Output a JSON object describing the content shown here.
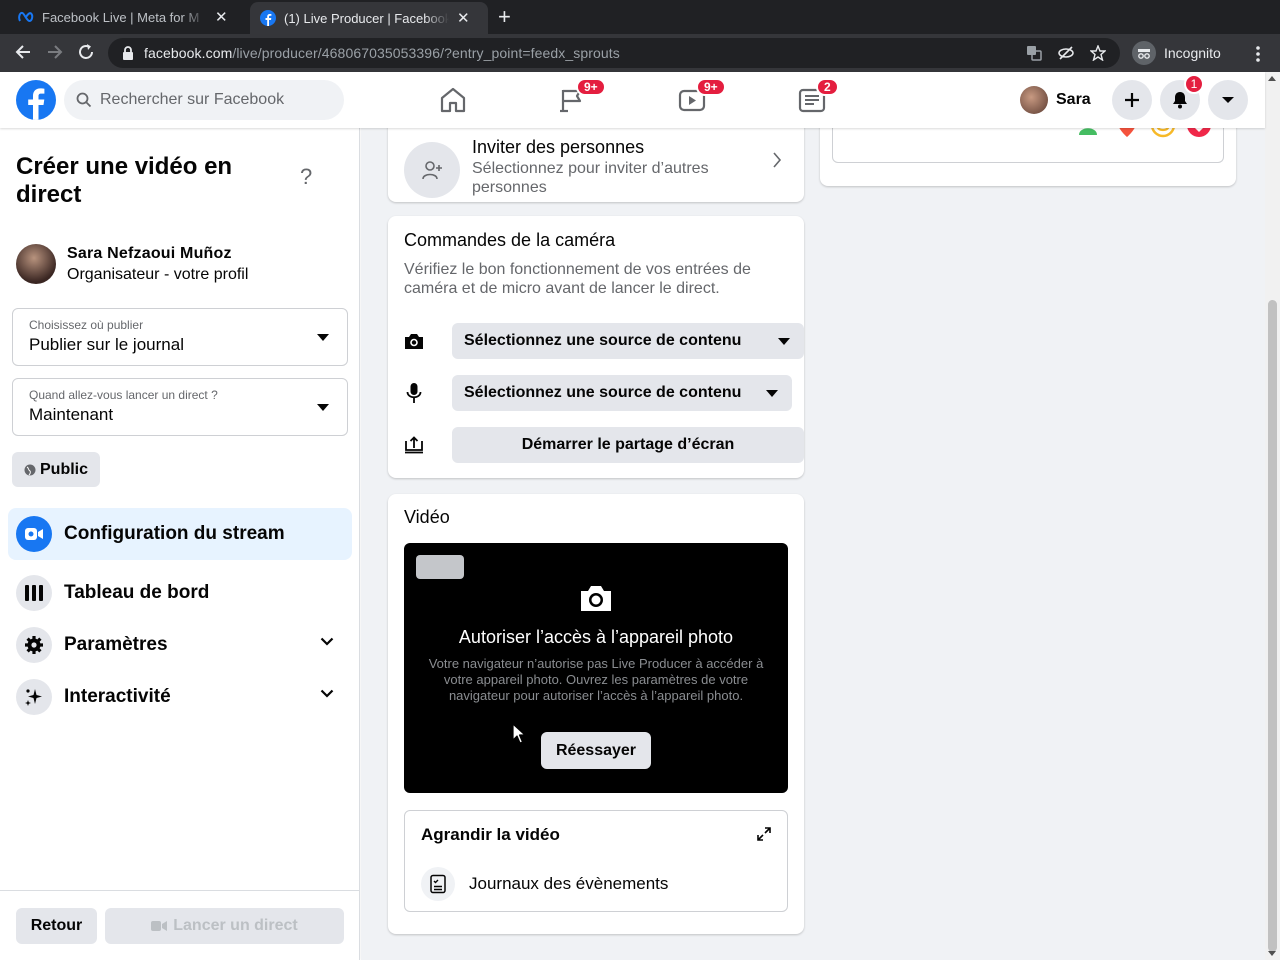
{
  "browser": {
    "tabs": [
      {
        "title": "Facebook Live | Meta for M",
        "active": false
      },
      {
        "title": "(1) Live Producer | Facebook",
        "active": true
      }
    ],
    "url_host": "facebook.com",
    "url_path": "/live/producer/468067035053396/?entry_point=feedx_sprouts",
    "incognito_label": "Incognito"
  },
  "header": {
    "search_placeholder": "Rechercher sur Facebook",
    "nav_badges": {
      "pages": "9+",
      "watch": "9+",
      "news": "2"
    },
    "user_name": "Sara",
    "notification_count": "1",
    "brand_color": "#1877f2",
    "badge_color": "#e41e3f"
  },
  "sidebar": {
    "title": "Créer une vidéo en direct",
    "help": "?",
    "owner_name": "Sara Nefzaoui Muñoz",
    "owner_role": "Organisateur - votre profil",
    "publish_where": {
      "label": "Choisissez où publier",
      "value": "Publier sur le journal"
    },
    "when_live": {
      "label": "Quand allez-vous lancer un direct ?",
      "value": "Maintenant"
    },
    "audience": "Public",
    "menu": [
      {
        "label": "Configuration du stream",
        "icon": "video-camera-icon",
        "active": true
      },
      {
        "label": "Tableau de bord",
        "icon": "dashboard-icon",
        "active": false
      },
      {
        "label": "Paramètres",
        "icon": "gear-icon",
        "active": false
      },
      {
        "label": "Interactivité",
        "icon": "sparkle-icon",
        "active": false
      }
    ],
    "back_label": "Retour",
    "go_live_label": "Lancer un direct"
  },
  "main": {
    "invite": {
      "title": "Inviter des personnes",
      "subtitle": "Sélectionnez pour inviter d’autres personnes"
    },
    "camera_controls": {
      "title": "Commandes de la caméra",
      "description": "Vérifiez le bon fonctionnement de vos entrées de caméra et de micro avant de lancer le direct.",
      "camera_source": "Sélectionnez une source de contenu",
      "mic_source": "Sélectionnez une source de contenu",
      "share_screen": "Démarrer le partage d’écran"
    },
    "video": {
      "title": "Vidéo",
      "access_title": "Autoriser l’accès à l’appareil photo",
      "access_desc": "Votre navigateur n’autorise pas Live Producer à accéder à votre appareil photo. Ouvrez les paramètres de votre navigateur pour autoriser l’accès à l’appareil photo.",
      "retry": "Réessayer",
      "enlarge": "Agrandir la vidéo",
      "event_logs": "Journaux des évènements"
    }
  }
}
